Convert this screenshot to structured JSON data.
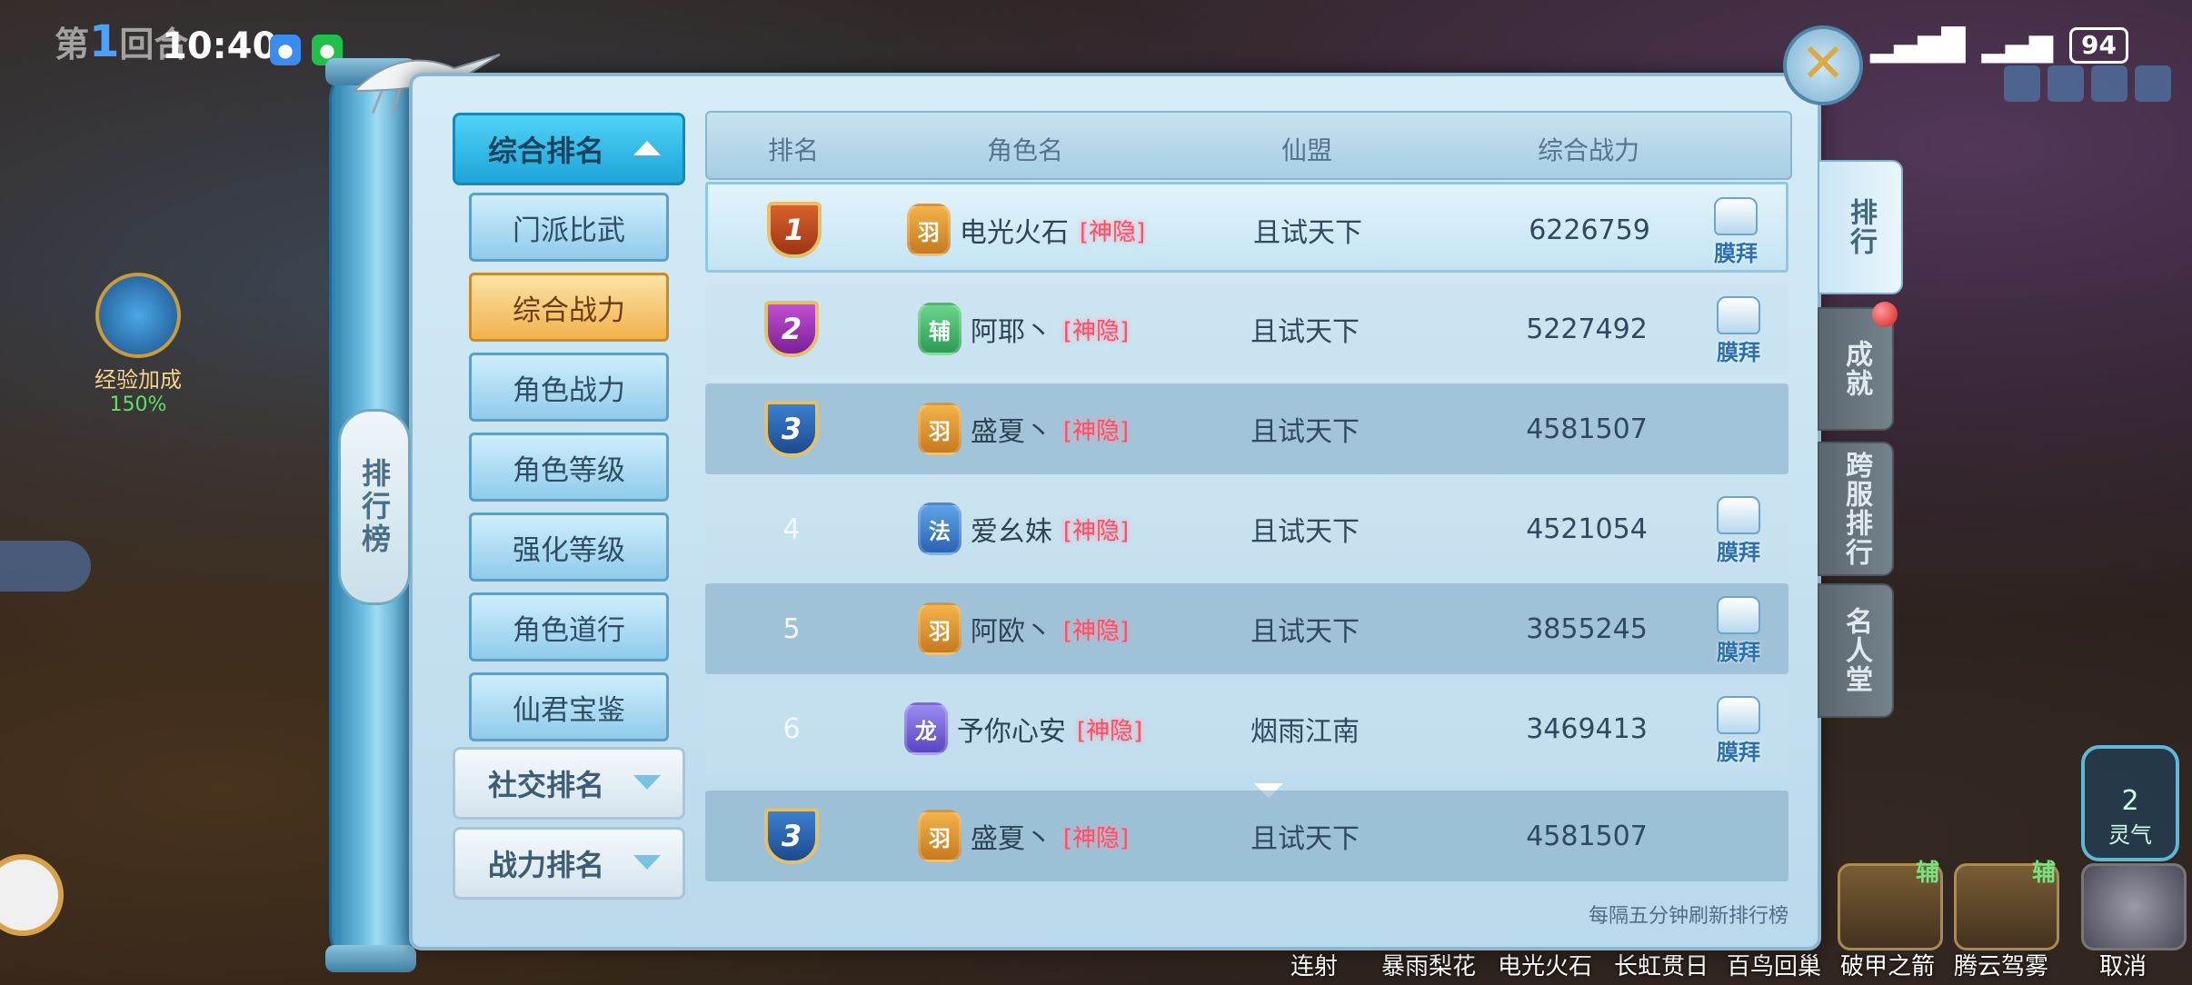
{
  "status_bar": {
    "time": "10:40",
    "battery": "94"
  },
  "hud": {
    "round_prefix": "第",
    "round_num": "1",
    "round_suffix": "回合",
    "exp_label": "经验加成",
    "exp_value": "150%",
    "spirit_num": "2",
    "spirit_label": "灵气",
    "skills": [
      {
        "name": "连射"
      },
      {
        "name": "暴雨梨花"
      },
      {
        "name": "电光火石"
      },
      {
        "name": "长虹贯日"
      },
      {
        "name": "百鸟回巢"
      },
      {
        "name": "破甲之箭"
      },
      {
        "name": "腾云驾雾"
      },
      {
        "name": "取消"
      }
    ],
    "skill_tag": "辅"
  },
  "panel": {
    "title": "排行榜",
    "categories": [
      {
        "label": "综合排名",
        "expanded": true
      },
      {
        "label": "社交排名",
        "expanded": false
      },
      {
        "label": "战力排名",
        "expanded": false
      }
    ],
    "subcategories": [
      {
        "label": "门派比武",
        "selected": false
      },
      {
        "label": "综合战力",
        "selected": true
      },
      {
        "label": "角色战力",
        "selected": false
      },
      {
        "label": "角色等级",
        "selected": false
      },
      {
        "label": "强化等级",
        "selected": false
      },
      {
        "label": "角色道行",
        "selected": false
      },
      {
        "label": "仙君宝鉴",
        "selected": false
      }
    ],
    "table_headers": [
      "排名",
      "角色名",
      "仙盟",
      "综合战力"
    ],
    "rows": [
      {
        "rank": "1",
        "sect": "羽",
        "name": "电光火石",
        "tag": "[神隐]",
        "guild": "且试天下",
        "power": "6226759",
        "like": "膜拜"
      },
      {
        "rank": "2",
        "sect": "辅",
        "name": "阿耶丶",
        "tag": "[神隐]",
        "guild": "且试天下",
        "power": "5227492",
        "like": "膜拜"
      },
      {
        "rank": "3",
        "sect": "羽",
        "name": "盛夏丶",
        "tag": "[神隐]",
        "guild": "且试天下",
        "power": "4581507",
        "like": ""
      },
      {
        "rank": "4",
        "sect": "法",
        "name": "爱幺妹",
        "tag": "[神隐]",
        "guild": "且试天下",
        "power": "4521054",
        "like": "膜拜"
      },
      {
        "rank": "5",
        "sect": "羽",
        "name": "阿欧丶",
        "tag": "[神隐]",
        "guild": "且试天下",
        "power": "3855245",
        "like": "膜拜"
      },
      {
        "rank": "6",
        "sect": "龙",
        "name": "予你心安",
        "tag": "[神隐]",
        "guild": "烟雨江南",
        "power": "3469413",
        "like": "膜拜"
      }
    ],
    "my_row": {
      "rank": "3",
      "sect": "羽",
      "name": "盛夏丶",
      "tag": "[神隐]",
      "guild": "且试天下",
      "power": "4581507"
    },
    "footer_note": "每隔五分钟刷新排行榜"
  },
  "right_tabs": [
    {
      "label": "排行",
      "active": true
    },
    {
      "label": "成就",
      "active": false
    },
    {
      "label": "跨服排行",
      "active": false
    },
    {
      "label": "名人堂",
      "active": false
    }
  ]
}
